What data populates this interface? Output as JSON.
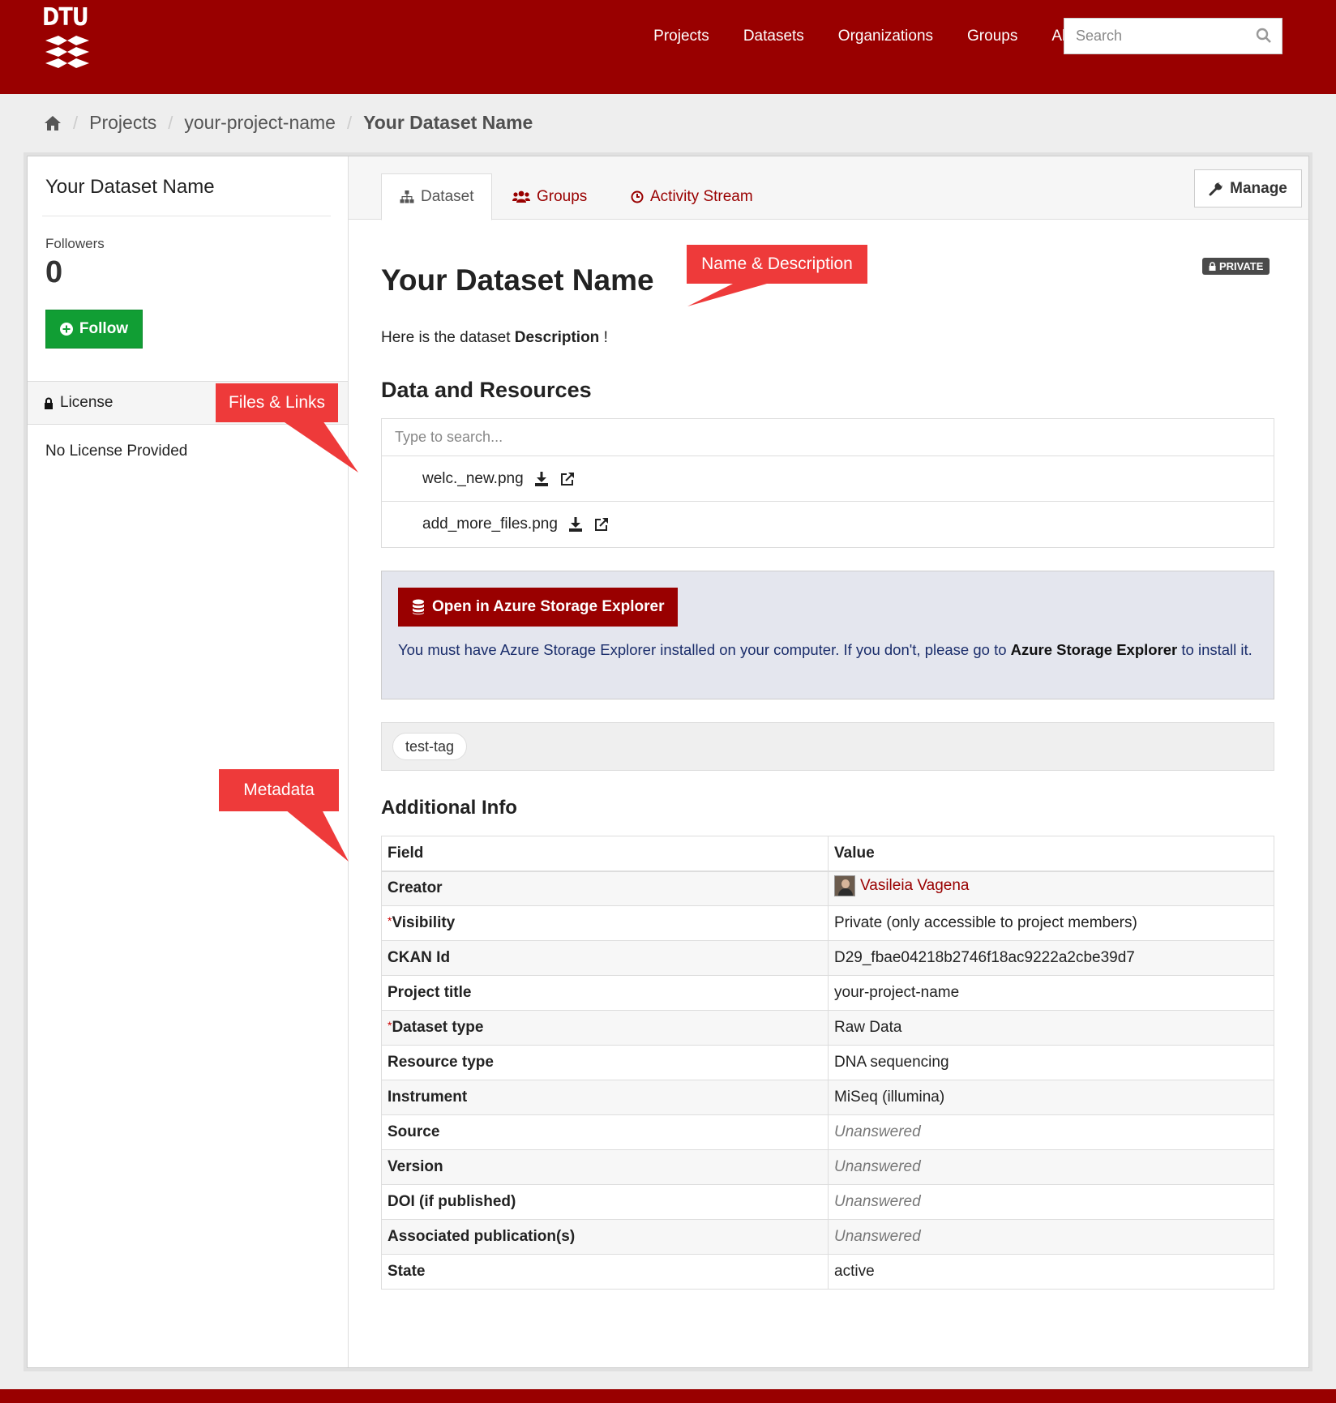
{
  "header": {
    "logo_text": "DTU",
    "nav": [
      "Projects",
      "Datasets",
      "Organizations",
      "Groups",
      "About"
    ],
    "search_placeholder": "Search",
    "brand_color": "#990000"
  },
  "breadcrumb": {
    "items": [
      "Projects",
      "your-project-name"
    ],
    "current": "Your Dataset Name"
  },
  "sidebar": {
    "title": "Your Dataset Name",
    "followers_label": "Followers",
    "followers_count": "0",
    "follow_label": "Follow",
    "license_heading": "License",
    "license_value": "No License Provided"
  },
  "tabs": [
    {
      "label": "Dataset",
      "icon": "sitemap-icon",
      "active": true
    },
    {
      "label": "Groups",
      "icon": "users-icon",
      "active": false
    },
    {
      "label": "Activity Stream",
      "icon": "clock-icon",
      "active": false
    }
  ],
  "manage_label": "Manage",
  "dataset": {
    "title": "Your Dataset Name",
    "visibility_badge": "PRIVATE",
    "description_prefix": "Here is the dataset ",
    "description_bold": "Description",
    "description_suffix": " !"
  },
  "resources": {
    "heading": "Data and Resources",
    "search_placeholder": "Type to search...",
    "items": [
      "welc._new.png",
      "add_more_files.png"
    ]
  },
  "azure": {
    "button_label": "Open in Azure Storage Explorer",
    "note_prefix": "You must have Azure Storage Explorer installed on your computer. If you don't, please go to ",
    "note_bold": "Azure Storage Explorer",
    "note_suffix": " to install it."
  },
  "tags": [
    "test-tag"
  ],
  "additional_info": {
    "heading": "Additional Info",
    "columns": [
      "Field",
      "Value"
    ],
    "rows": [
      {
        "field": "Creator",
        "value": "Vasileia Vagena",
        "required": false,
        "type": "link"
      },
      {
        "field": "Visibility",
        "value": "Private (only accessible to project members)",
        "required": true,
        "type": "text"
      },
      {
        "field": "CKAN Id",
        "value": "D29_fbae04218b2746f18ac9222a2cbe39d7",
        "required": false,
        "type": "text"
      },
      {
        "field": "Project title",
        "value": "your-project-name",
        "required": false,
        "type": "text"
      },
      {
        "field": "Dataset type",
        "value": "Raw Data",
        "required": true,
        "type": "text"
      },
      {
        "field": "Resource type",
        "value": "DNA sequencing",
        "required": false,
        "type": "text"
      },
      {
        "field": "Instrument",
        "value": "MiSeq (illumina)",
        "required": false,
        "type": "text"
      },
      {
        "field": "Source",
        "value": "Unanswered",
        "required": false,
        "type": "unanswered"
      },
      {
        "field": "Version",
        "value": "Unanswered",
        "required": false,
        "type": "unanswered"
      },
      {
        "field": "DOI (if published)",
        "value": "Unanswered",
        "required": false,
        "type": "unanswered"
      },
      {
        "field": "Associated publication(s)",
        "value": "Unanswered",
        "required": false,
        "type": "unanswered"
      },
      {
        "field": "State",
        "value": "active",
        "required": false,
        "type": "text"
      }
    ]
  },
  "callouts": {
    "name_description": "Name & Description",
    "files_links": "Files & Links",
    "metadata": "Metadata",
    "color": "#ee3a3a"
  }
}
